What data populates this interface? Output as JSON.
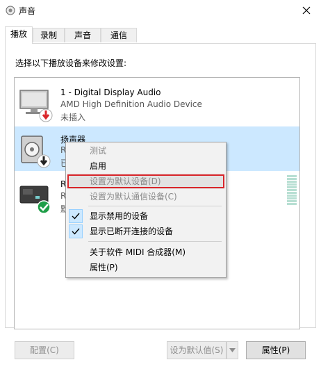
{
  "window": {
    "title": "声音"
  },
  "tabs": [
    {
      "label": "播放",
      "active": true
    },
    {
      "label": "录制",
      "active": false
    },
    {
      "label": "声音",
      "active": false
    },
    {
      "label": "通信",
      "active": false
    }
  ],
  "instruction": "选择以下播放设备来修改设置:",
  "devices": [
    {
      "name": "1 - Digital Display Audio",
      "description": "AMD High Definition Audio Device",
      "status": "未插入",
      "icon": "monitor-icon",
      "badge": "unplugged-badge-icon"
    },
    {
      "name": "扬声器",
      "description": "R",
      "status": "已",
      "icon": "speaker-icon",
      "badge": "disabled-badge-icon",
      "selected": true
    },
    {
      "name": "R",
      "description": "R",
      "status": "默",
      "icon": "digital-output-icon",
      "badge": "default-check-icon"
    }
  ],
  "context_menu": {
    "items": [
      {
        "label": "测试",
        "disabled": true
      },
      {
        "label": "启用",
        "disabled": false
      },
      {
        "label": "设置为默认设备(D)",
        "disabled": true,
        "highlighted": true
      },
      {
        "label": "设置为默认通信设备(C)",
        "disabled": true
      },
      {
        "label": "显示禁用的设备",
        "checked": true
      },
      {
        "label": "显示已断开连接的设备",
        "checked": true
      },
      {
        "label": "关于软件 MIDI 合成器(M)",
        "disabled": false
      },
      {
        "label": "属性(P)",
        "disabled": false
      }
    ]
  },
  "buttons": {
    "configure": "配置(C)",
    "set_default": "设为默认值(S)",
    "properties": "属性(P)"
  },
  "colors": {
    "selection": "#cce8ff",
    "highlight_box": "#d9252a",
    "default_check": "#1f9e48",
    "unplugged_badge": "#d9252a"
  }
}
